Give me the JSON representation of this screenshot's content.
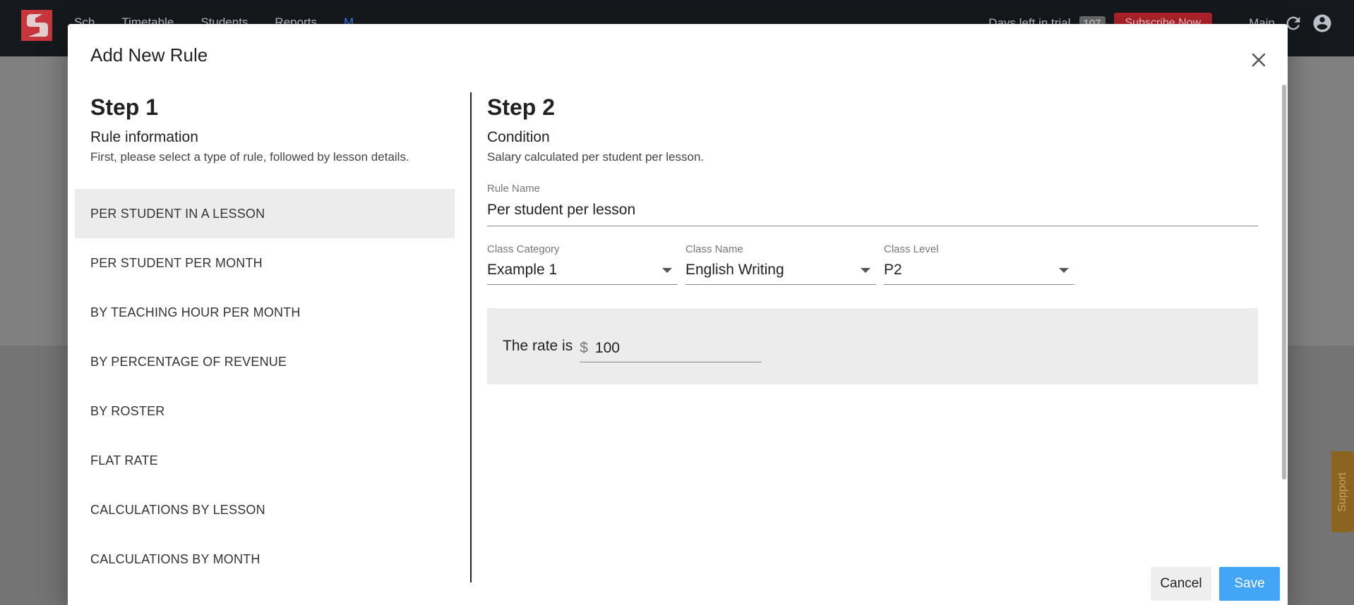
{
  "app": {
    "nav": [
      "Sch",
      "Timetable",
      "Students",
      "Reports",
      "M"
    ],
    "trial_text": "Days left in trial",
    "trial_count": "107",
    "subscribe_label": "Subscribe Now",
    "main_label": "Main",
    "support_label": "Support"
  },
  "modal": {
    "title": "Add New Rule",
    "step1": {
      "heading": "Step 1",
      "subtitle": "Rule information",
      "description": "First, please select a type of rule, followed by lesson details.",
      "rules": [
        "PER STUDENT IN A LESSON",
        "PER STUDENT PER MONTH",
        "BY TEACHING HOUR PER MONTH",
        "BY PERCENTAGE OF REVENUE",
        "BY ROSTER",
        "FLAT RATE",
        "CALCULATIONS BY LESSON",
        "CALCULATIONS BY MONTH"
      ],
      "selected_index": 0
    },
    "step2": {
      "heading": "Step 2",
      "subtitle": "Condition",
      "description": "Salary calculated per student per lesson.",
      "rule_name_label": "Rule Name",
      "rule_name_value": "Per student per lesson",
      "class_category_label": "Class Category",
      "class_category_value": "Example 1",
      "class_name_label": "Class Name",
      "class_name_value": "English Writing",
      "class_level_label": "Class Level",
      "class_level_value": "P2",
      "rate_label": "The rate is",
      "currency_symbol": "$",
      "rate_value": "100"
    },
    "buttons": {
      "cancel": "Cancel",
      "save": "Save"
    }
  },
  "colors": {
    "save_button": "#42a5f5",
    "selected_rule_bg": "#ececec",
    "app_bar": "#15191d",
    "subscribe": "#b0232a"
  }
}
